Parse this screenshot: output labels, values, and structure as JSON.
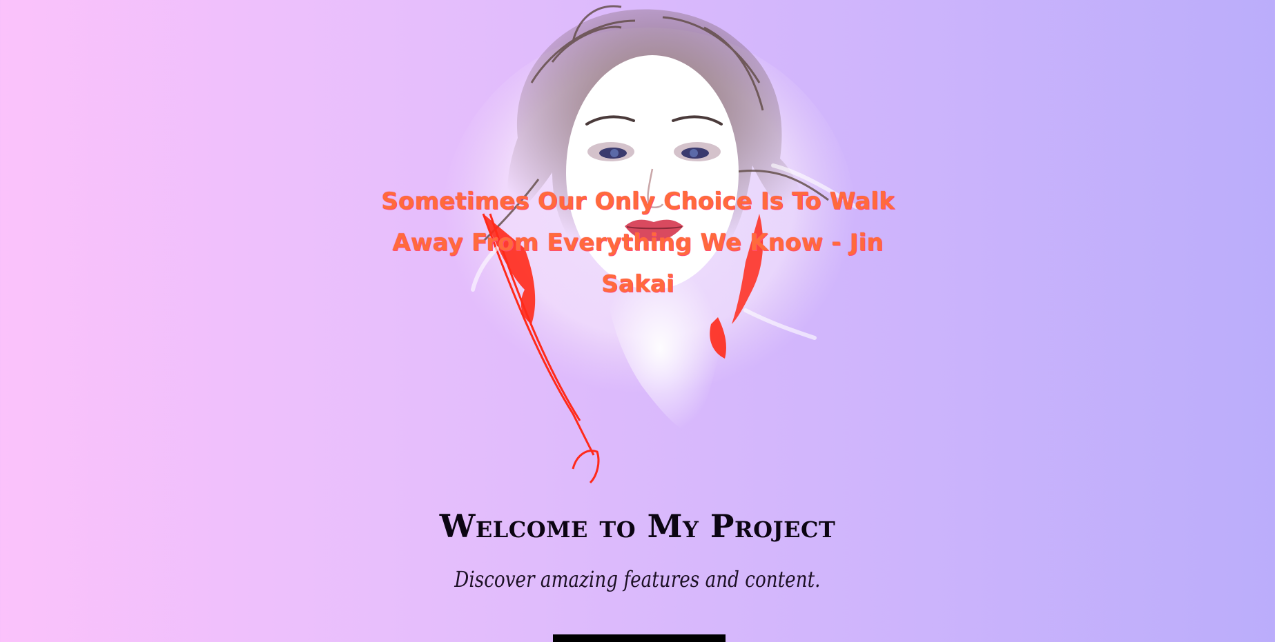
{
  "hero": {
    "quote": "Sometimes Our Only Choice Is To Walk Away From Everything We Know - Jin Sakai",
    "portrait_image": "watercolor-woman-portrait"
  },
  "welcome": {
    "title": "Welcome to My Project",
    "subtitle": "Discover amazing features and content."
  },
  "colors": {
    "background_start": "#fbc2fb",
    "background_end": "#bbadfb",
    "quote_color": "#ff6a3c",
    "title_color": "#0c0512",
    "button_color": "#000000"
  }
}
